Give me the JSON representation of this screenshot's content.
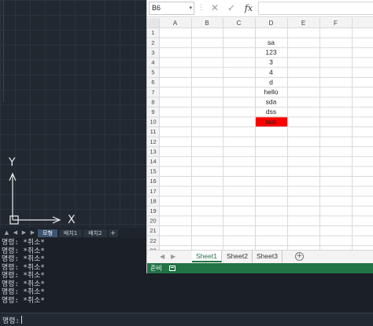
{
  "cad": {
    "ucs": {
      "y_label": "Y",
      "x_label": "X"
    },
    "layout_tabs": [
      {
        "label": "모형",
        "active": true
      },
      {
        "label": "배치1",
        "active": false
      },
      {
        "label": "배치2",
        "active": false
      }
    ],
    "layout_add_label": "+",
    "command_history": [
      "명령: *취소*",
      "명령: *취소*",
      "명령: *취소*",
      "명령: *취소*",
      "명령: *취소*",
      "명령: *취소*",
      "명령: *취소*",
      "명령: *취소*"
    ],
    "command_prompt": "명령:"
  },
  "excel": {
    "name_box": "B6",
    "columns": [
      "A",
      "B",
      "C",
      "D",
      "E",
      "F"
    ],
    "row_numbers": [
      "1",
      "2",
      "3",
      "4",
      "5",
      "6",
      "7",
      "8",
      "9",
      "10",
      "11",
      "12",
      "13",
      "14",
      "15",
      "16",
      "17",
      "18",
      "19",
      "20",
      "21",
      "22",
      "23"
    ],
    "cells": [
      {
        "col": "D",
        "row": 2,
        "value": "sa"
      },
      {
        "col": "D",
        "row": 3,
        "value": "123"
      },
      {
        "col": "D",
        "row": 4,
        "value": "3"
      },
      {
        "col": "D",
        "row": 5,
        "value": "4"
      },
      {
        "col": "D",
        "row": 6,
        "value": "d"
      },
      {
        "col": "D",
        "row": 7,
        "value": "hello"
      },
      {
        "col": "D",
        "row": 8,
        "value": "sda"
      },
      {
        "col": "D",
        "row": 9,
        "value": "dss"
      },
      {
        "col": "D",
        "row": 10,
        "value": "last",
        "fill": "#ff0000"
      }
    ],
    "sheet_tabs": [
      {
        "label": "Sheet1",
        "active": true
      },
      {
        "label": "Sheet2",
        "active": false
      },
      {
        "label": "Sheet3",
        "active": false
      }
    ],
    "add_sheet_label": "+",
    "status": "준비",
    "colors": {
      "accent": "#217346",
      "highlight": "#ff0000"
    }
  }
}
